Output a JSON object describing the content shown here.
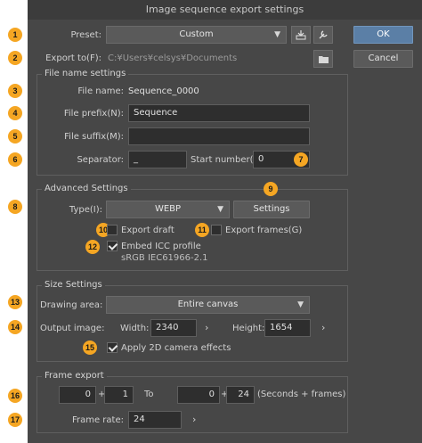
{
  "title": "Image sequence export settings",
  "buttons": {
    "ok": "OK",
    "cancel": "Cancel",
    "settings": "Settings"
  },
  "preset": {
    "label": "Preset:",
    "value": "Custom"
  },
  "export_to": {
    "label": "Export to(F):",
    "path": "C:¥Users¥celsys¥Documents"
  },
  "file_name_settings": {
    "title": "File name settings",
    "file_name_label": "File name:",
    "file_name_value": "Sequence_0000",
    "prefix_label": "File prefix(N):",
    "prefix_value": "Sequence",
    "suffix_label": "File suffix(M):",
    "suffix_value": "",
    "separator_label": "Separator:",
    "separator_value": "_",
    "start_number_label": "Start number(C):",
    "start_number_value": "0"
  },
  "advanced": {
    "title": "Advanced Settings",
    "type_label": "Type(I):",
    "type_value": "WEBP",
    "export_draft": "Export draft",
    "export_frames": "Export frames(G)",
    "embed_icc": "Embed ICC profile",
    "icc_name": "sRGB IEC61966-2.1"
  },
  "size": {
    "title": "Size Settings",
    "drawing_area_label": "Drawing area:",
    "drawing_area_value": "Entire canvas",
    "output_image_label": "Output image:",
    "width_label": "Width:",
    "width_value": "2340",
    "height_label": "Height:",
    "height_value": "1654",
    "camera_effects": "Apply 2D camera effects"
  },
  "frame_export": {
    "title": "Frame export",
    "from_seconds": "0",
    "from_frames": "1",
    "to_label": "To",
    "to_seconds": "0",
    "to_frames": "24",
    "unit_label": "(Seconds + frames)",
    "plus": "+",
    "frame_rate_label": "Frame rate:",
    "frame_rate_value": "24"
  },
  "badges": [
    "1",
    "2",
    "3",
    "4",
    "5",
    "6",
    "7",
    "8",
    "9",
    "10",
    "11",
    "12",
    "13",
    "14",
    "15",
    "16",
    "17"
  ],
  "colors": {
    "dialog_bg": "#474747",
    "badge": "#f5a623",
    "primary": "#5b7fa6"
  },
  "icons": {
    "save_preset": "save-preset-icon",
    "edit_preset": "wrench-icon",
    "folder": "folder-icon",
    "chevron": "chevron-down-icon",
    "arrow": "chevron-right-icon"
  }
}
